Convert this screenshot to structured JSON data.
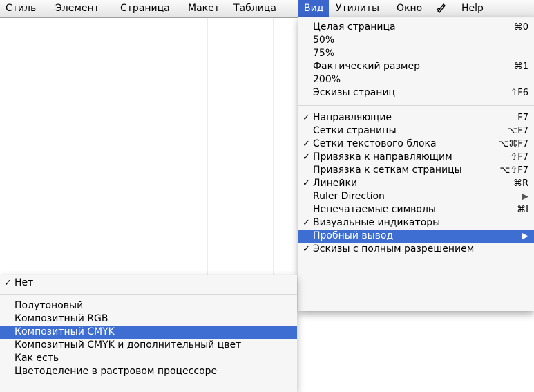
{
  "menubar": {
    "items": [
      "Стиль",
      "Элемент",
      "Страница",
      "Макет",
      "Таблица",
      "Вид",
      "Утилиты",
      "Окно",
      "Help"
    ],
    "icon": "script-menu-icon",
    "active": "Вид"
  },
  "view_menu": {
    "items": [
      {
        "label": "Целая страница",
        "shortcut": "⌘0",
        "checked": false
      },
      {
        "label": "50%",
        "shortcut": "",
        "checked": false
      },
      {
        "label": "75%",
        "shortcut": "",
        "checked": false
      },
      {
        "label": "Фактический размер",
        "shortcut": "⌘1",
        "checked": false
      },
      {
        "label": "200%",
        "shortcut": "",
        "checked": false
      },
      {
        "label": "Эскизы страниц",
        "shortcut": "⇧F6",
        "checked": false
      },
      {
        "label": "Направляющие",
        "shortcut": "F7",
        "checked": true
      },
      {
        "label": "Сетки страницы",
        "shortcut": "⌥F7",
        "checked": false
      },
      {
        "label": "Сетки текстового блока",
        "shortcut": "⌥⌘F7",
        "checked": true
      },
      {
        "label": "Привязка к направляющим",
        "shortcut": "⇧F7",
        "checked": true
      },
      {
        "label": "Привязка к сеткам страницы",
        "shortcut": "⌥⇧F7",
        "checked": false
      },
      {
        "label": "Линейки",
        "shortcut": "⌘R",
        "checked": true
      },
      {
        "label": "Ruler Direction",
        "shortcut": "▶",
        "checked": false
      },
      {
        "label": "Непечатаемые символы",
        "shortcut": "⌘I",
        "checked": false
      },
      {
        "label": "Визуальные индикаторы",
        "shortcut": "",
        "checked": true
      },
      {
        "label": "Пробный вывод",
        "shortcut": "▶",
        "checked": false,
        "highlighted": true
      },
      {
        "label": "Эскизы с полным разрешением",
        "shortcut": "",
        "checked": true
      }
    ]
  },
  "proof_menu": {
    "items": [
      {
        "label": "Нет",
        "checked": true
      },
      {
        "label": "Полутоновый",
        "checked": false
      },
      {
        "label": "Композитный RGB",
        "checked": false
      },
      {
        "label": "Композитный CMYK",
        "checked": false,
        "highlighted": true
      },
      {
        "label": "Композитный CMYK и дополнительный цвет",
        "checked": false
      },
      {
        "label": "Как есть",
        "checked": false
      },
      {
        "label": "Цветоделение в растровом процессоре",
        "checked": false
      }
    ]
  },
  "check_glyph": "✓",
  "colors": {
    "highlight": "#3e6ed1",
    "menubar_active": "#3b66cc"
  }
}
